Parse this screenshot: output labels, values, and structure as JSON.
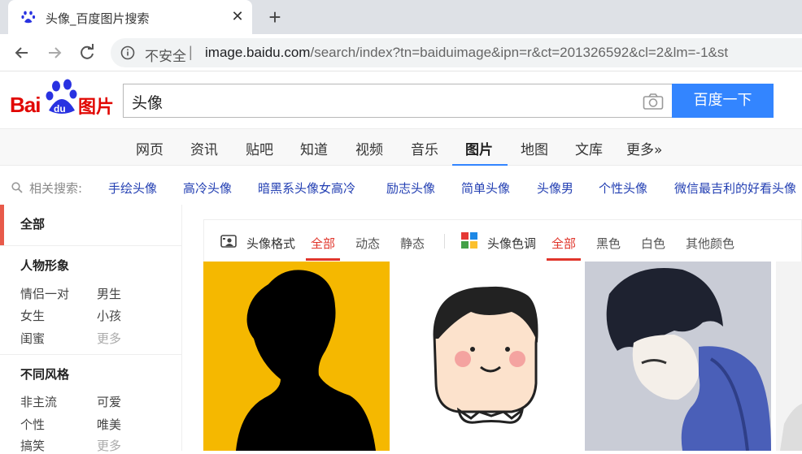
{
  "browser": {
    "tab_title": "头像_百度图片搜索",
    "close_glyph": "✕",
    "new_tab_glyph": "+",
    "insecure_label": "不安全",
    "url_separator": "|",
    "url_host": "image.baidu.com",
    "url_path": "/search/index?tn=baiduimage&ipn=r&ct=201326592&cl=2&lm=-1&st"
  },
  "header": {
    "logo_text": "Bai",
    "logo_du": "du",
    "logo_cn": "图片",
    "search_value": "头像",
    "search_button": "百度一下"
  },
  "nav": {
    "items": [
      "网页",
      "资讯",
      "贴吧",
      "知道",
      "视频",
      "音乐",
      "图片",
      "地图",
      "文库",
      "更多»"
    ],
    "active_index": 6
  },
  "related": {
    "label": "相关搜索:",
    "items": [
      "手绘头像",
      "高冷头像",
      "暗黑系头像女高冷",
      "励志头像",
      "简单头像",
      "头像男",
      "个性头像",
      "微信最吉利的好看头像"
    ]
  },
  "sidebar": {
    "all": "全部",
    "section1": {
      "title": "人物形象",
      "links": [
        "情侣一对",
        "男生",
        "女生",
        "小孩",
        "闺蜜",
        "更多"
      ]
    },
    "section2": {
      "title": "不同风格",
      "links": [
        "非主流",
        "可爱",
        "个性",
        "唯美",
        "搞笑",
        "更多"
      ]
    }
  },
  "filters": {
    "format_label": "头像格式",
    "format_options": [
      "全部",
      "动态",
      "静态"
    ],
    "color_label": "头像色调",
    "color_options": [
      "全部",
      "黑色",
      "白色",
      "其他颜色"
    ]
  },
  "colors": {
    "baidu_red": "#e10601",
    "baidu_blue": "#3385ff",
    "link_blue": "#2440b3",
    "active_red": "#e0352b",
    "tile1_bg": "#f5b800"
  }
}
